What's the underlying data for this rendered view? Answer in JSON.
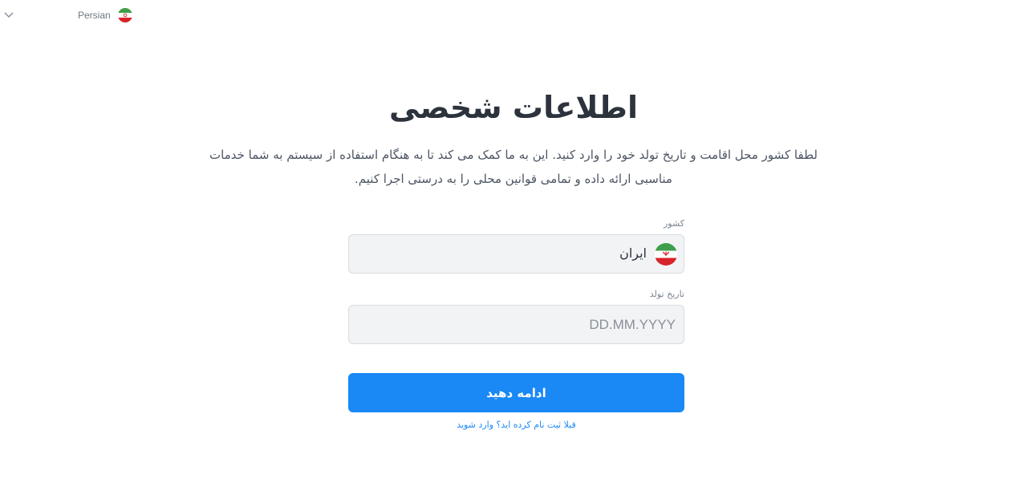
{
  "language_selector": {
    "label": "Persian",
    "chevron_icon": "chevron-down-icon",
    "flag_icon": "iran-flag-icon"
  },
  "header": {
    "title": "اطلاعات شخصی",
    "description": "لطفا کشور محل اقامت و تاریخ تولد خود را وارد کنید. این به ما کمک می کند تا به هنگام استفاده از سیستم به شما خدمات مناسبی ارائه داده و تمامی قوانین محلی را به درستی اجرا کنیم."
  },
  "form": {
    "country_label": "کشور",
    "country_value": "ایران",
    "country_flag_icon": "iran-flag-icon",
    "birth_label": "تاریخ تولد",
    "birth_placeholder": "DD.MM.YYYY",
    "continue_label": "ادامه دهید",
    "login_link": "قبلا ثبت نام کرده اید؟ وارد شوید"
  },
  "colors": {
    "accent": "#1a88f5",
    "field_bg": "#f2f3f5",
    "title": "#2d333d",
    "flag_green": "#3f9e4a",
    "flag_red": "#d8232a"
  }
}
